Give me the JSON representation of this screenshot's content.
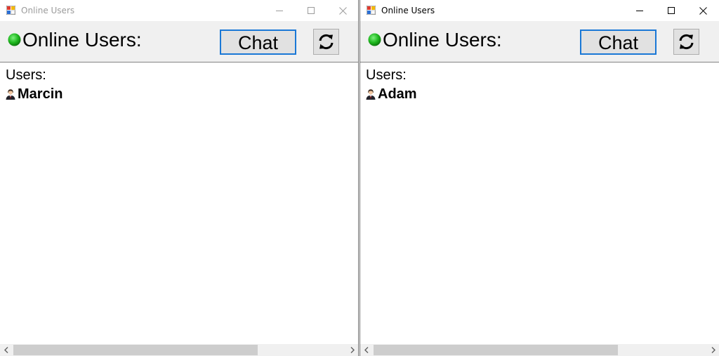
{
  "windows": [
    {
      "title": "Online Users",
      "header": {
        "label": "Online Users:",
        "status_color": "#1fb81f"
      },
      "chat_button": "Chat",
      "refresh_icon": "refresh-icon",
      "list": {
        "heading": "Users:",
        "users": [
          "Marcin"
        ]
      },
      "active": false
    },
    {
      "title": "Online Users",
      "header": {
        "label": "Online Users:",
        "status_color": "#1fb81f"
      },
      "chat_button": "Chat",
      "refresh_icon": "refresh-icon",
      "list": {
        "heading": "Users:",
        "users": [
          "Adam"
        ]
      },
      "active": true
    }
  ],
  "colors": {
    "accent": "#1a78d6",
    "button_bg": "#e1e1e1",
    "window_bg": "#f0f0f0"
  }
}
